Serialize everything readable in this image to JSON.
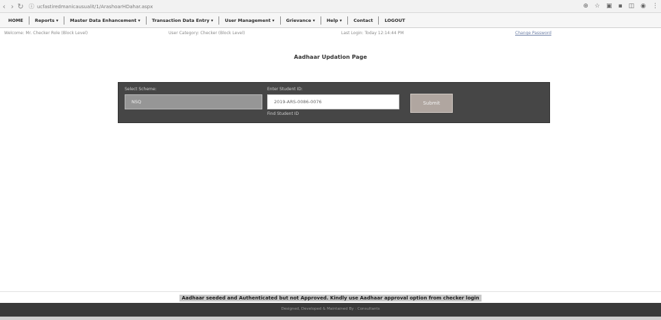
{
  "browser": {
    "url": "ucfastiredmanicausualit/1/ArashoarHDahar.aspx"
  },
  "menu": {
    "items": [
      "HOME",
      "Reports ▾",
      "Master Data Enhancement ▾",
      "Transaction Data Entry ▾",
      "User Management ▾",
      "Grievance ▾",
      "Help ▾",
      "Contact",
      "LOGOUT"
    ]
  },
  "info_bar": {
    "left_text": "Welcome: Mr. Checker Role (Block Level)",
    "center_text": "User Category: Checker (Block Level)",
    "right_text": "Last Login: Today 12:14:44 PM",
    "link_text": "Change Password"
  },
  "page": {
    "title": "Aadhaar Updation Page"
  },
  "form": {
    "select_label": "Select Scheme:",
    "select_value": "NSQ",
    "input_label": "Enter Student ID:",
    "input_value": "2019-ARS-0086-0076",
    "input_hint": "Find Student ID",
    "submit_label": "Submit"
  },
  "status": {
    "message": "Aadhaar seeded and Authenticated but not Approved. Kindly use Aadhaar approval option from checker login"
  },
  "footer": {
    "text": "Designed, Developed & Maintained By : Consultants"
  }
}
